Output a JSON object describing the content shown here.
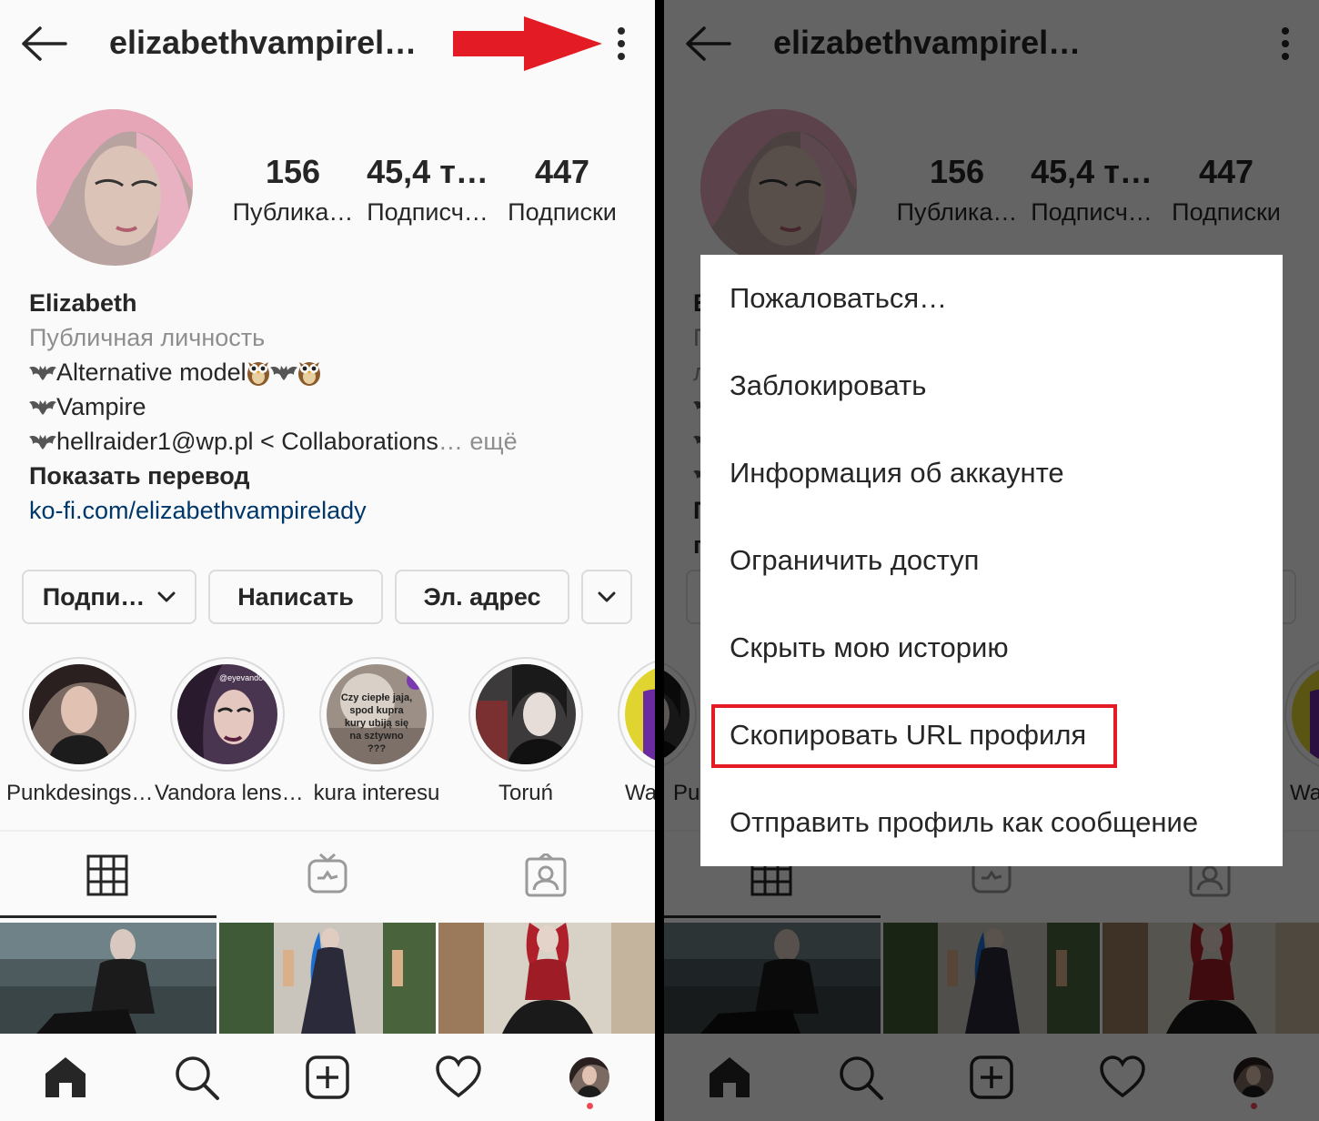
{
  "profile": {
    "username": "elizabethvampirel…",
    "stats": [
      {
        "value": "156",
        "label": "Публика…"
      },
      {
        "value": "45,4 т…",
        "label": "Подписч…"
      },
      {
        "value": "447",
        "label": "Подписки"
      }
    ],
    "bio": {
      "name": "Elizabeth",
      "category": "Публичная личность",
      "line1": "Alternative model",
      "line2": "Vampire",
      "line3": "hellraider1@wp.pl < Collaborations",
      "more": "… ещё",
      "translate": "Показать перевод",
      "link": "ko-fi.com/elizabethvampirelady"
    }
  },
  "actions": {
    "follow": "Подпи…",
    "message": "Написать",
    "email": "Эл. адрес"
  },
  "highlights": [
    {
      "label": "Punkdesings…",
      "overlay": ""
    },
    {
      "label": "Vandora lens…",
      "overlay": "@eyevandora"
    },
    {
      "label": "kura interesu",
      "overlay": "Czy ciepłe jaja, spod kupra kury ubiją się na sztywno ???"
    },
    {
      "label": "Toruń",
      "overlay": ""
    },
    {
      "label": "Wa",
      "overlay": ""
    }
  ],
  "right_highlights": [
    {
      "label": "Pu"
    },
    {
      "label": "Wa"
    }
  ],
  "menu": {
    "items": [
      "Пожаловаться…",
      "Заблокировать",
      "Информация об аккаунте",
      "Ограничить доступ",
      "Скрыть мою историю",
      "Скопировать URL профиля",
      "Отправить профиль как сообщение"
    ],
    "highlighted_index": 5
  },
  "colors": {
    "link": "#00376b",
    "annotation_red": "#e21b24",
    "notification_dot": "#ed4956",
    "muted_text": "#8e8e8e"
  },
  "icons": [
    "back-arrow-icon",
    "more-vertical-icon",
    "grid-icon",
    "igtv-icon",
    "tagged-icon",
    "home-icon",
    "search-icon",
    "new-post-icon",
    "heart-icon",
    "chevron-down-icon",
    "bat-icon",
    "owl-icon"
  ]
}
